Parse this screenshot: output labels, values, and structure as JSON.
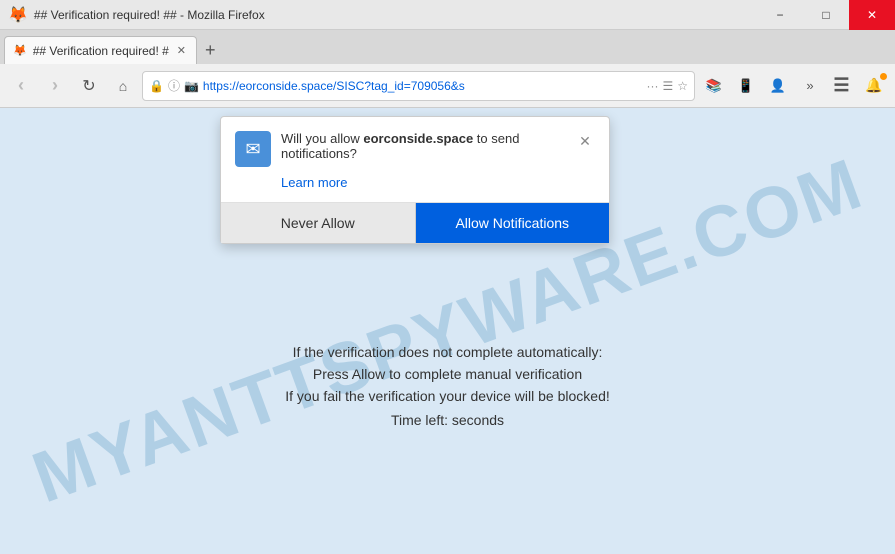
{
  "titlebar": {
    "title": "## Verification required! ## - Mozilla Firefox",
    "icon": "🦊",
    "controls": {
      "minimize": "−",
      "maximize": "□",
      "close": "✕"
    }
  },
  "tab": {
    "title": "## Verification required! #",
    "close": "✕"
  },
  "tab_new": "+",
  "navbar": {
    "back": "‹",
    "forward": "›",
    "reload": "↻",
    "home": "⌂",
    "url": "https://eorconside.space/SISC?tag_id=709056&s",
    "more": "···",
    "bookmarks": "☆",
    "library": "📚",
    "synced": "👤",
    "extend": "»",
    "bell": "🔔"
  },
  "popup": {
    "icon": "✉",
    "message_pre": "Will you allow ",
    "message_domain": "eorconside.space",
    "message_post": " to send notifications?",
    "learn_more": "Learn more",
    "close_icon": "✕",
    "never_allow_label": "Never Allow",
    "allow_label": "Allow Notifications"
  },
  "page": {
    "line1": "If the verification does not complete automatically:",
    "line2": "Press Allow to complete manual verification",
    "line3": "If you fail the verification your device will be blocked!",
    "timer": "Time left: seconds"
  },
  "watermark": "MYANTTSPYWARE.COM"
}
